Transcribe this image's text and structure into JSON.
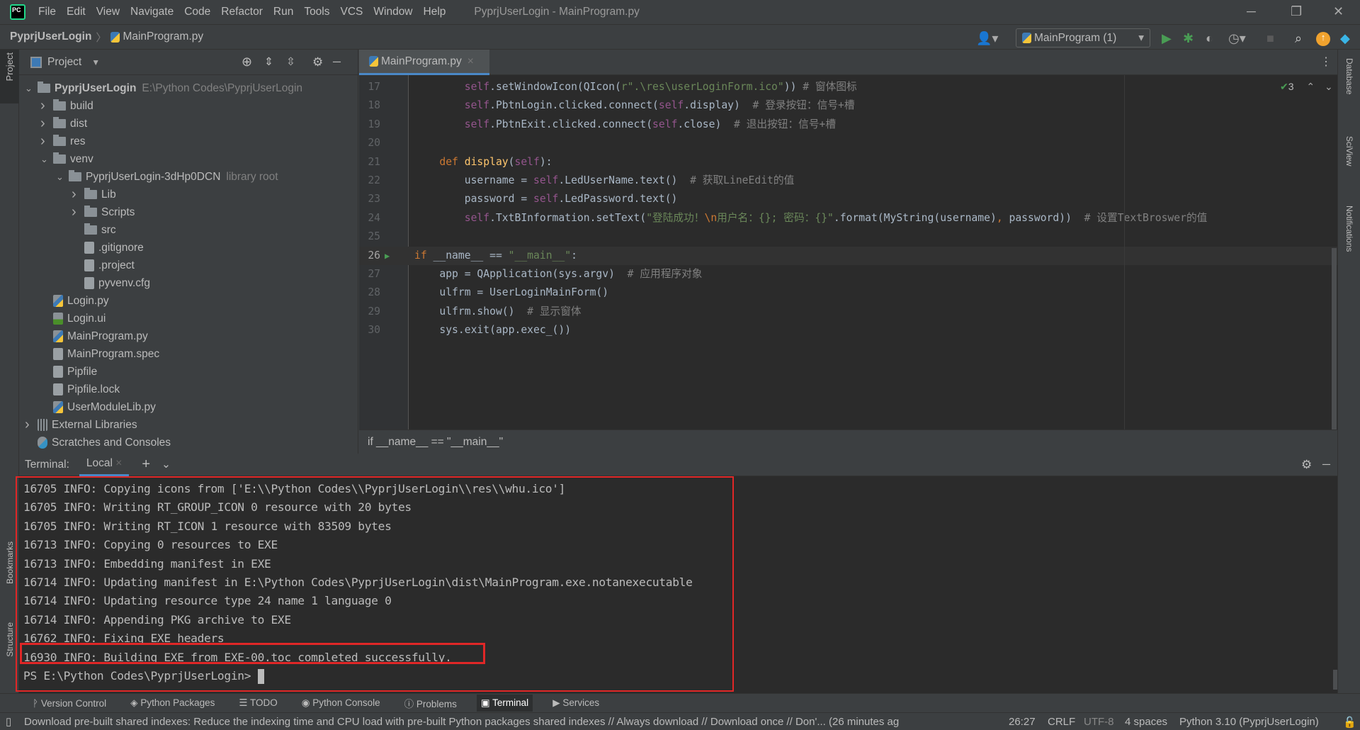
{
  "app": {
    "title": "PyprjUserLogin - MainProgram.py",
    "logo": "PC"
  },
  "menu": [
    "File",
    "Edit",
    "View",
    "Navigate",
    "Code",
    "Refactor",
    "Run",
    "Tools",
    "VCS",
    "Window",
    "Help"
  ],
  "nav": {
    "project": "PyprjUserLogin",
    "file": "MainProgram.py",
    "run_config": "MainProgram (1)"
  },
  "project_panel": {
    "title": "Project",
    "strip_label": "Project",
    "tree": [
      {
        "level": 0,
        "arrow": "down",
        "icon": "folder",
        "label": "PyprjUserLogin",
        "hint": "E:\\Python Codes\\PyprjUserLogin",
        "bold": true
      },
      {
        "level": 1,
        "arrow": "right",
        "icon": "folder",
        "label": "build"
      },
      {
        "level": 1,
        "arrow": "right",
        "icon": "folder",
        "label": "dist"
      },
      {
        "level": 1,
        "arrow": "right",
        "icon": "folder",
        "label": "res"
      },
      {
        "level": 1,
        "arrow": "down",
        "icon": "folder",
        "label": "venv"
      },
      {
        "level": 2,
        "arrow": "down",
        "icon": "folder",
        "label": "PyprjUserLogin-3dHp0DCN",
        "hint": "library root"
      },
      {
        "level": 3,
        "arrow": "right",
        "icon": "folder",
        "label": "Lib"
      },
      {
        "level": 3,
        "arrow": "right",
        "icon": "folder",
        "label": "Scripts"
      },
      {
        "level": 3,
        "arrow": "",
        "icon": "folder",
        "label": "src"
      },
      {
        "level": 3,
        "arrow": "",
        "icon": "file",
        "label": ".gitignore"
      },
      {
        "level": 3,
        "arrow": "",
        "icon": "file",
        "label": ".project"
      },
      {
        "level": 3,
        "arrow": "",
        "icon": "file",
        "label": "pyvenv.cfg"
      },
      {
        "level": 1,
        "arrow": "",
        "icon": "py",
        "label": "Login.py"
      },
      {
        "level": 1,
        "arrow": "",
        "icon": "ui",
        "label": "Login.ui"
      },
      {
        "level": 1,
        "arrow": "",
        "icon": "py",
        "label": "MainProgram.py"
      },
      {
        "level": 1,
        "arrow": "",
        "icon": "file",
        "label": "MainProgram.spec"
      },
      {
        "level": 1,
        "arrow": "",
        "icon": "file",
        "label": "Pipfile"
      },
      {
        "level": 1,
        "arrow": "",
        "icon": "file",
        "label": "Pipfile.lock"
      },
      {
        "level": 1,
        "arrow": "",
        "icon": "py",
        "label": "UserModuleLib.py"
      },
      {
        "level": 0,
        "arrow": "right",
        "icon": "lib",
        "label": "External Libraries"
      },
      {
        "level": 0,
        "arrow": "",
        "icon": "scr",
        "label": "Scratches and Consoles"
      }
    ]
  },
  "editor": {
    "tab": "MainProgram.py",
    "inspections": "3",
    "breadcrumb": "if __name__ == \"__main__\"",
    "current_line": 26,
    "colors": {
      "self": "#94558d",
      "kw": "#cc7832",
      "str": "#6a8759",
      "cm": "#808080",
      "fn": "#ffc66d",
      "tx": "#a9b7c6"
    },
    "lines": [
      {
        "n": 17,
        "t": [
          [
            "        ",
            "tx"
          ],
          [
            "self",
            "self"
          ],
          [
            ".setWindowIcon(QIcon(",
            "tx"
          ],
          [
            "r\".\\res\\userLoginForm.ico\"",
            "str"
          ],
          [
            ")) ",
            "tx"
          ],
          [
            "# 窗体图标",
            "cm"
          ]
        ]
      },
      {
        "n": 18,
        "t": [
          [
            "        ",
            "tx"
          ],
          [
            "self",
            "self"
          ],
          [
            ".PbtnLogin.clicked.connect(",
            "tx"
          ],
          [
            "self",
            "self"
          ],
          [
            ".display)  ",
            "tx"
          ],
          [
            "# 登录按钮：信号+槽",
            "cm"
          ]
        ]
      },
      {
        "n": 19,
        "t": [
          [
            "        ",
            "tx"
          ],
          [
            "self",
            "self"
          ],
          [
            ".PbtnExit.clicked.connect(",
            "tx"
          ],
          [
            "self",
            "self"
          ],
          [
            ".close)  ",
            "tx"
          ],
          [
            "# 退出按钮：信号+槽",
            "cm"
          ]
        ]
      },
      {
        "n": 20,
        "t": []
      },
      {
        "n": 21,
        "t": [
          [
            "    ",
            "tx"
          ],
          [
            "def ",
            "kw"
          ],
          [
            "display",
            "fn"
          ],
          [
            "(",
            "tx"
          ],
          [
            "self",
            "self"
          ],
          [
            "):",
            "tx"
          ]
        ]
      },
      {
        "n": 22,
        "t": [
          [
            "        username = ",
            "tx"
          ],
          [
            "self",
            "self"
          ],
          [
            ".LedUserName.text()  ",
            "tx"
          ],
          [
            "# 获取LineEdit的值",
            "cm"
          ]
        ]
      },
      {
        "n": 23,
        "t": [
          [
            "        password = ",
            "tx"
          ],
          [
            "self",
            "self"
          ],
          [
            ".LedPassword.text()",
            "tx"
          ]
        ]
      },
      {
        "n": 24,
        "t": [
          [
            "        ",
            "tx"
          ],
          [
            "self",
            "self"
          ],
          [
            ".TxtBInformation.setText(",
            "tx"
          ],
          [
            "\"登陆成功！",
            "str"
          ],
          [
            "\\n",
            "kw"
          ],
          [
            "用户名：{}; 密码：{}\"",
            "str"
          ],
          [
            ".format(MyString(username)",
            "tx"
          ],
          [
            ", ",
            "kw"
          ],
          [
            "password))  ",
            "tx"
          ],
          [
            "# 设置TextBroswer的值",
            "cm"
          ]
        ]
      },
      {
        "n": 25,
        "t": []
      },
      {
        "n": 26,
        "t": [
          [
            "if ",
            "kw"
          ],
          [
            "__name__ == ",
            "tx"
          ],
          [
            "\"__main__\"",
            "str"
          ],
          [
            ":",
            "tx"
          ]
        ]
      },
      {
        "n": 27,
        "t": [
          [
            "    app = QApplication(sys.argv)  ",
            "tx"
          ],
          [
            "# 应用程序对象",
            "cm"
          ]
        ]
      },
      {
        "n": 28,
        "t": [
          [
            "    ulfrm = UserLoginMainForm()",
            "tx"
          ]
        ]
      },
      {
        "n": 29,
        "t": [
          [
            "    ulfrm.show()  ",
            "tx"
          ],
          [
            "# 显示窗体",
            "cm"
          ]
        ]
      },
      {
        "n": 30,
        "t": [
          [
            "    sys.exit(app.exec_())",
            "tx"
          ]
        ]
      }
    ]
  },
  "terminal": {
    "label": "Terminal:",
    "tab": "Local",
    "lines": [
      "16705 INFO: Copying icons from ['E:\\\\Python Codes\\\\PyprjUserLogin\\\\res\\\\whu.ico']",
      "16705 INFO: Writing RT_GROUP_ICON 0 resource with 20 bytes",
      "16705 INFO: Writing RT_ICON 1 resource with 83509 bytes",
      "16713 INFO: Copying 0 resources to EXE",
      "16713 INFO: Embedding manifest in EXE",
      "16714 INFO: Updating manifest in E:\\Python Codes\\PyprjUserLogin\\dist\\MainProgram.exe.notanexecutable",
      "16714 INFO: Updating resource type 24 name 1 language 0",
      "16714 INFO: Appending PKG archive to EXE",
      "16762 INFO: Fixing EXE headers",
      "16930 INFO: Building EXE from EXE-00.toc completed successfully."
    ],
    "prompt": "PS E:\\Python Codes\\PyprjUserLogin>"
  },
  "side_labels": {
    "bookmarks": "Bookmarks",
    "structure": "Structure",
    "database": "Database",
    "sciview": "SciView",
    "notifications": "Notifications"
  },
  "toolwindows": [
    {
      "label": "Version Control"
    },
    {
      "label": "Python Packages"
    },
    {
      "label": "TODO"
    },
    {
      "label": "Python Console"
    },
    {
      "label": "Problems"
    },
    {
      "label": "Terminal",
      "active": true
    },
    {
      "label": "Services"
    }
  ],
  "status": {
    "message": "Download pre-built shared indexes: Reduce the indexing time and CPU load with pre-built Python packages shared indexes // Always download // Download once // Don'... (26 minutes ag",
    "position": "26:27",
    "line_sep": "CRLF",
    "encoding": "UTF-8",
    "indent": "4 spaces",
    "interpreter": "Python 3.10 (PyprjUserLogin)"
  },
  "highlight_color": "#e02727"
}
